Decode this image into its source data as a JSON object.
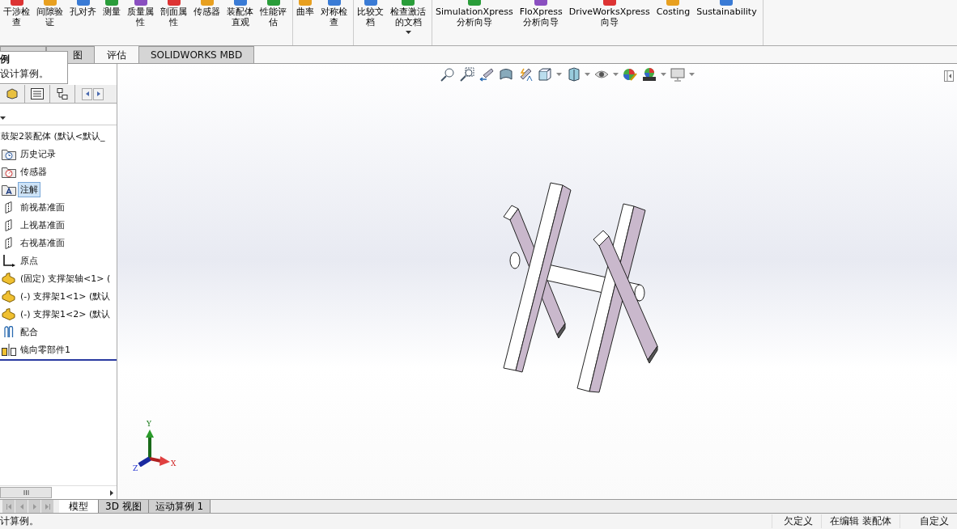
{
  "ribbon": {
    "groups": [
      {
        "items": [
          {
            "lines": [
              "干涉检",
              "查"
            ],
            "dropdown": false
          },
          {
            "lines": [
              "间隙验",
              "证"
            ],
            "dropdown": false
          },
          {
            "lines": [
              "孔对齐"
            ],
            "dropdown": false
          },
          {
            "lines": [
              "测量"
            ],
            "dropdown": false
          },
          {
            "lines": [
              "质量属",
              "性"
            ],
            "dropdown": false
          },
          {
            "lines": [
              "剖面属",
              "性"
            ],
            "dropdown": false
          },
          {
            "lines": [
              "传感器"
            ],
            "dropdown": false
          },
          {
            "lines": [
              "装配体",
              "直观"
            ],
            "dropdown": false
          },
          {
            "lines": [
              "性能评",
              "估"
            ],
            "dropdown": false
          }
        ]
      },
      {
        "items": [
          {
            "lines": [
              "曲率"
            ],
            "dropdown": false
          },
          {
            "lines": [
              "对称检",
              "查"
            ],
            "dropdown": false
          }
        ]
      },
      {
        "items": [
          {
            "lines": [
              "比较文",
              "档"
            ],
            "dropdown": false
          },
          {
            "lines": [
              "检查激活",
              "的文档"
            ],
            "dropdown": true
          }
        ]
      },
      {
        "items": [
          {
            "lines": [
              "SimulationXpress",
              "分析向导"
            ],
            "dropdown": false
          },
          {
            "lines": [
              "FloXpress",
              "分析向导"
            ],
            "dropdown": false
          },
          {
            "lines": [
              "DriveWorksXpress",
              "向导"
            ],
            "dropdown": false
          },
          {
            "lines": [
              "Costing"
            ],
            "dropdown": false
          },
          {
            "lines": [
              "Sustainability"
            ],
            "dropdown": false
          }
        ]
      }
    ]
  },
  "tabs": [
    {
      "label": "图",
      "selected": false
    },
    {
      "label": "评估",
      "selected": true
    },
    {
      "label": "SOLIDWORKS MBD",
      "selected": false
    }
  ],
  "tooltip": {
    "title": "例",
    "text": "设计算例。"
  },
  "tree": {
    "root": "鼓架2装配体 (默认<默认_",
    "items": [
      {
        "kind": "history",
        "label": "历史记录",
        "selected": false
      },
      {
        "kind": "sensor",
        "label": "传感器",
        "selected": false
      },
      {
        "kind": "annotation",
        "label": "注解",
        "selected": true
      },
      {
        "kind": "plane",
        "label": "前视基准面",
        "selected": false
      },
      {
        "kind": "plane",
        "label": "上视基准面",
        "selected": false
      },
      {
        "kind": "plane",
        "label": "右视基准面",
        "selected": false
      },
      {
        "kind": "origin",
        "label": "原点",
        "selected": false
      },
      {
        "kind": "part",
        "label": "(固定) 支撑架轴<1> (",
        "selected": false
      },
      {
        "kind": "part",
        "label": "(-) 支撑架1<1> (默认",
        "selected": false
      },
      {
        "kind": "part",
        "label": "(-) 支撑架1<2> (默认",
        "selected": false
      },
      {
        "kind": "mates",
        "label": "配合",
        "selected": false
      },
      {
        "kind": "mirror",
        "label": "镜向零部件1",
        "selected": false
      }
    ]
  },
  "triad": {
    "x": "X",
    "y": "Y",
    "z": "Z"
  },
  "bottom_tabs": [
    {
      "label": "模型",
      "selected": true
    },
    {
      "label": "3D 视图",
      "selected": false
    },
    {
      "label": "运动算例 1",
      "selected": false
    }
  ],
  "status_bar": {
    "message": "计算例。",
    "fields": [
      "欠定义",
      "在编辑 装配体",
      "自定义"
    ]
  }
}
